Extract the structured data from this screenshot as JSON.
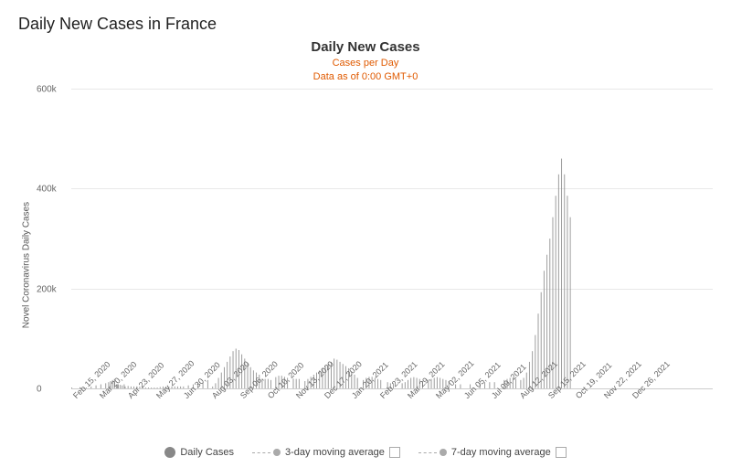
{
  "page": {
    "title": "Daily New Cases in France"
  },
  "chart": {
    "title": "Daily New Cases",
    "subtitle_line1": "Cases per Day",
    "subtitle_line2": "Data as of 0:00 GMT+0",
    "y_axis_label": "Novel Coronavirus Daily Cases",
    "y_ticks": [
      {
        "label": "600k",
        "pct": 0
      },
      {
        "label": "400k",
        "pct": 33.3
      },
      {
        "label": "200k",
        "pct": 66.7
      },
      {
        "label": "0",
        "pct": 100
      }
    ],
    "x_labels": [
      "Feb 15, 2020",
      "Mar 20, 2020",
      "Apr 23, 2020",
      "May 27, 2020",
      "Jun 30, 2020",
      "Aug 03, 2020",
      "Sep 06, 2020",
      "Oct 10, 2020",
      "Nov 13, 2020",
      "Dec 17, 2020",
      "Jan 20, 2021",
      "Feb 23, 2021",
      "Mar 29, 2021",
      "May 02, 2021",
      "Jun 05, 2021",
      "Jul 09, 2021",
      "Aug 12, 2021",
      "Sep 15, 2021",
      "Oct 19, 2021",
      "Nov 22, 2021",
      "Dec 26, 2021"
    ]
  },
  "legend": {
    "daily_cases_label": "Daily Cases",
    "ma3_label": "3-day moving average",
    "ma7_label": "7-day moving average"
  }
}
